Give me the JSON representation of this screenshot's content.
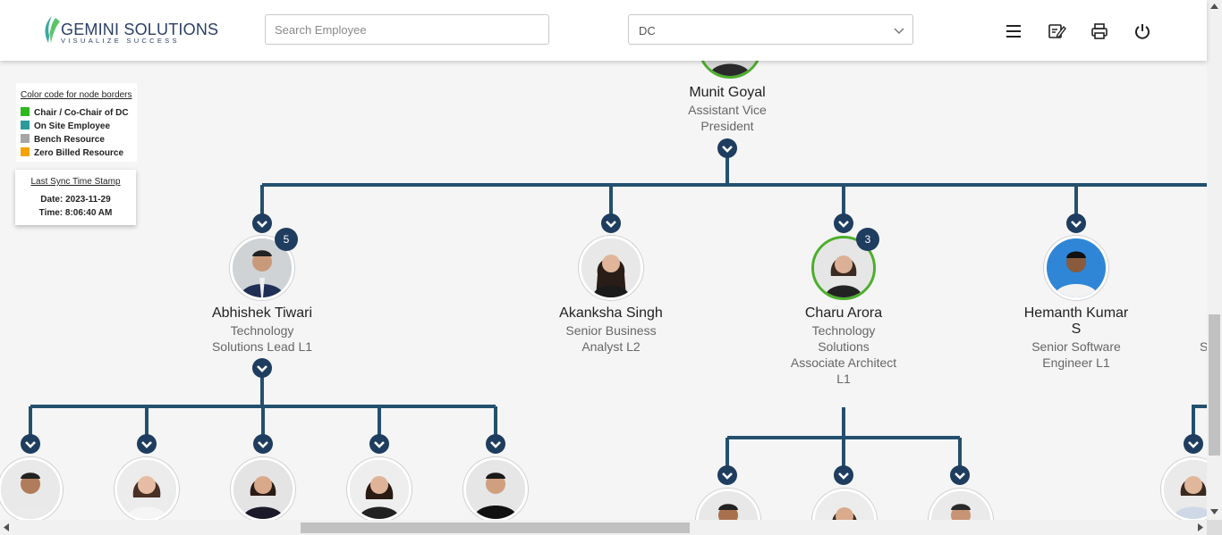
{
  "header": {
    "logo_main": "GEMINI SOLUTIONS",
    "logo_sub": "VISUALIZE SUCCESS",
    "search_placeholder": "Search Employee",
    "select_value": "DC",
    "icons": [
      "menu-icon",
      "edit-icon",
      "print-icon",
      "power-icon"
    ]
  },
  "legend": {
    "title": "Color code for node borders",
    "items": [
      {
        "label": "Chair / Co-Chair of DC",
        "color": "#2db81d"
      },
      {
        "label": "On Site Employee",
        "color": "#2e9b9b"
      },
      {
        "label": "Bench Resource",
        "color": "#a6a6a6"
      },
      {
        "label": "Zero Billed Resource",
        "color": "#f5a300"
      }
    ]
  },
  "sync": {
    "title": "Last Sync Time Stamp",
    "date_line": "Date: 2023-11-29",
    "time_line": "Time: 8:06:40 AM"
  },
  "root": {
    "name": "Munit Goyal",
    "title_line1": "Assistant Vice",
    "title_line2": "President"
  },
  "children": [
    {
      "name": "Abhishek Tiwari",
      "title_lines": [
        "Technology",
        "Solutions Lead L1"
      ],
      "badge": "5"
    },
    {
      "name": "Akanksha Singh",
      "title_lines": [
        "Senior Business",
        "Analyst L2"
      ]
    },
    {
      "name": "Charu Arora",
      "title_lines": [
        "Technology",
        "Solutions",
        "Associate Architect",
        "L1"
      ],
      "badge": "3"
    },
    {
      "name_lines": [
        "Hemanth Kumar",
        "S"
      ],
      "title_lines": [
        "Senior Software",
        "Engineer L1"
      ]
    },
    {
      "partial_title": "S"
    }
  ],
  "colors": {
    "accent": "#1e3d5f",
    "line": "#24506f",
    "chair_border": "#4caf2c"
  }
}
